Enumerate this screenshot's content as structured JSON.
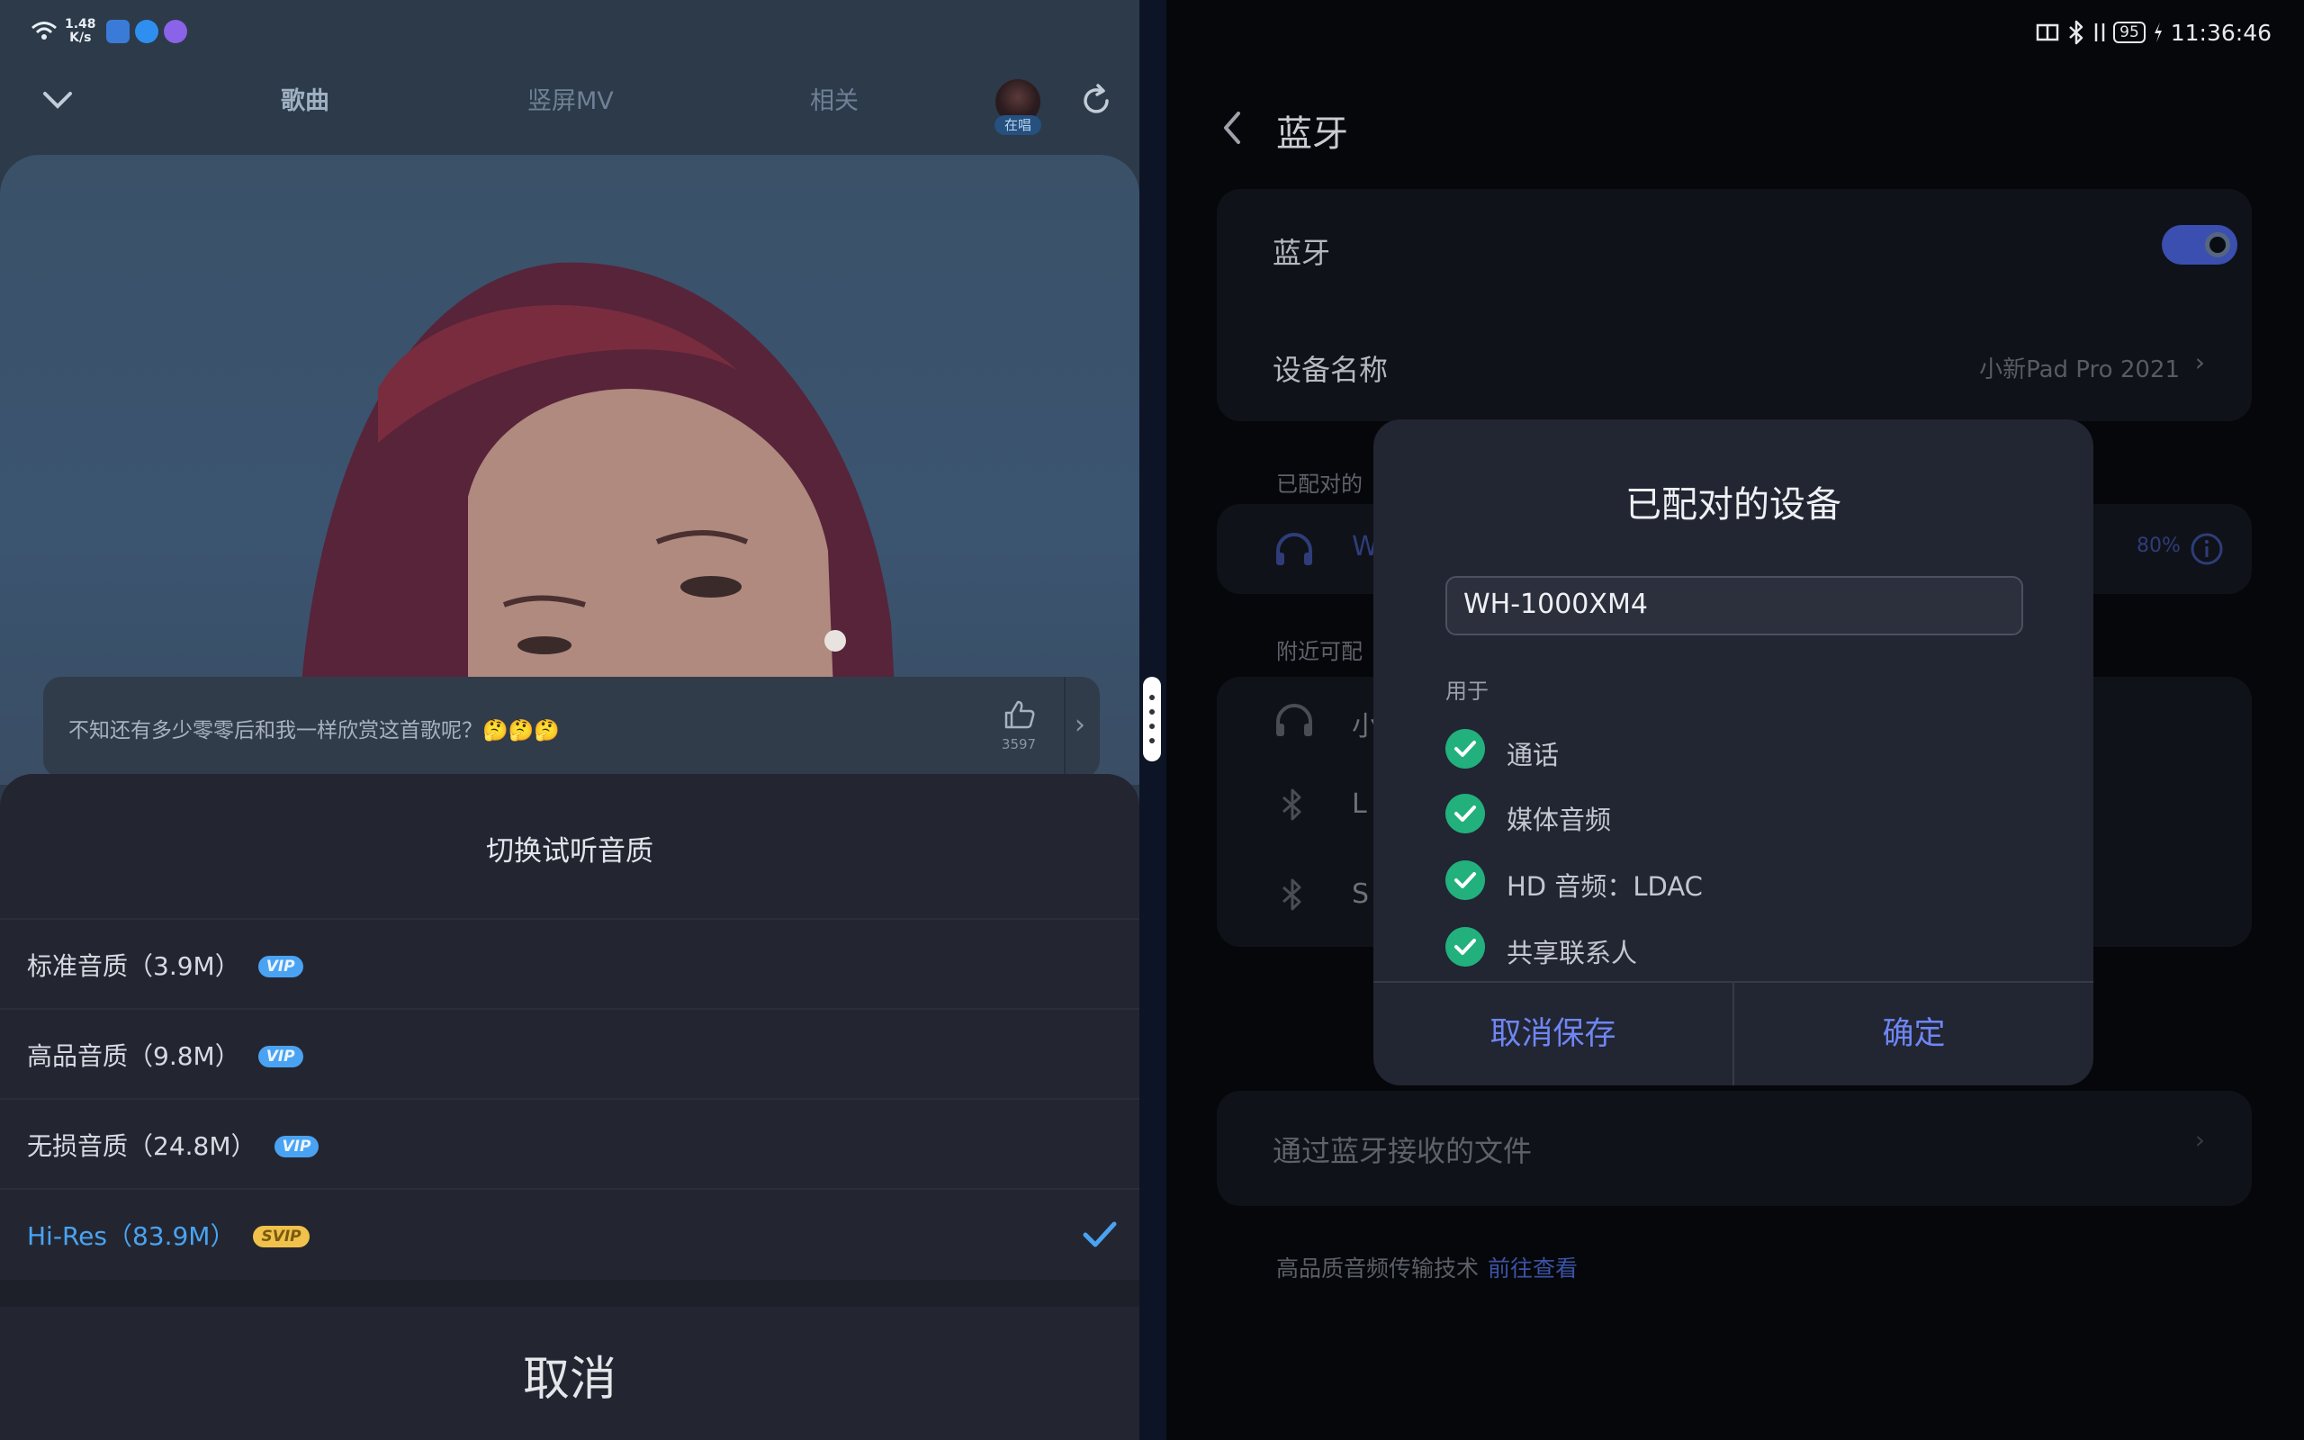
{
  "left": {
    "status": {
      "speed_top": "1.48",
      "speed_unit": "K/s"
    },
    "nav": {
      "tabs": [
        "歌曲",
        "竖屏MV",
        "相关"
      ],
      "avatar_badge": "在唱"
    },
    "comment": {
      "text": "不知还有多少零零后和我一样欣赏这首歌呢？🤔🤔🤔",
      "likes": "3597",
      "arrow": "›"
    },
    "quality_sheet": {
      "title": "切换试听音质",
      "options": [
        {
          "label": "标准音质（3.9M）",
          "badge": "VIP",
          "selected": false
        },
        {
          "label": "高品音质（9.8M）",
          "badge": "VIP",
          "selected": false
        },
        {
          "label": "无损音质（24.8M）",
          "badge": "VIP",
          "selected": false
        },
        {
          "label": "Hi-Res（83.9M）",
          "badge": "SVIP",
          "selected": true
        }
      ],
      "cancel": "取消"
    }
  },
  "right": {
    "status": {
      "battery": "95",
      "time": "11:36:46"
    },
    "title": "蓝牙",
    "bluetooth_label": "蓝牙",
    "bluetooth_on": true,
    "device_name_label": "设备名称",
    "device_name_value": "小新Pad Pro 2021",
    "paired_section": "已配对的",
    "paired_row_initial": "W",
    "paired_row_battery": "80%",
    "nearby_section": "附近可配",
    "nearby_initials": [
      "小",
      "L",
      "S"
    ],
    "received_files": "通过蓝牙接收的文件",
    "footer_text": "高品质音频传输技术",
    "footer_link": "前往查看",
    "dialog": {
      "title": "已配对的设备",
      "name_value": "WH-1000XM4",
      "used_for": "用于",
      "items": [
        "通话",
        "媒体音频",
        "HD 音频：LDAC",
        "共享联系人"
      ],
      "cancel_save": "取消保存",
      "confirm": "确定"
    }
  },
  "colors": {
    "accent_blue": "#4aa3f2",
    "svip_gold": "#f0c24b",
    "check_green": "#22b07d",
    "dialog_button": "#6e86f3"
  }
}
